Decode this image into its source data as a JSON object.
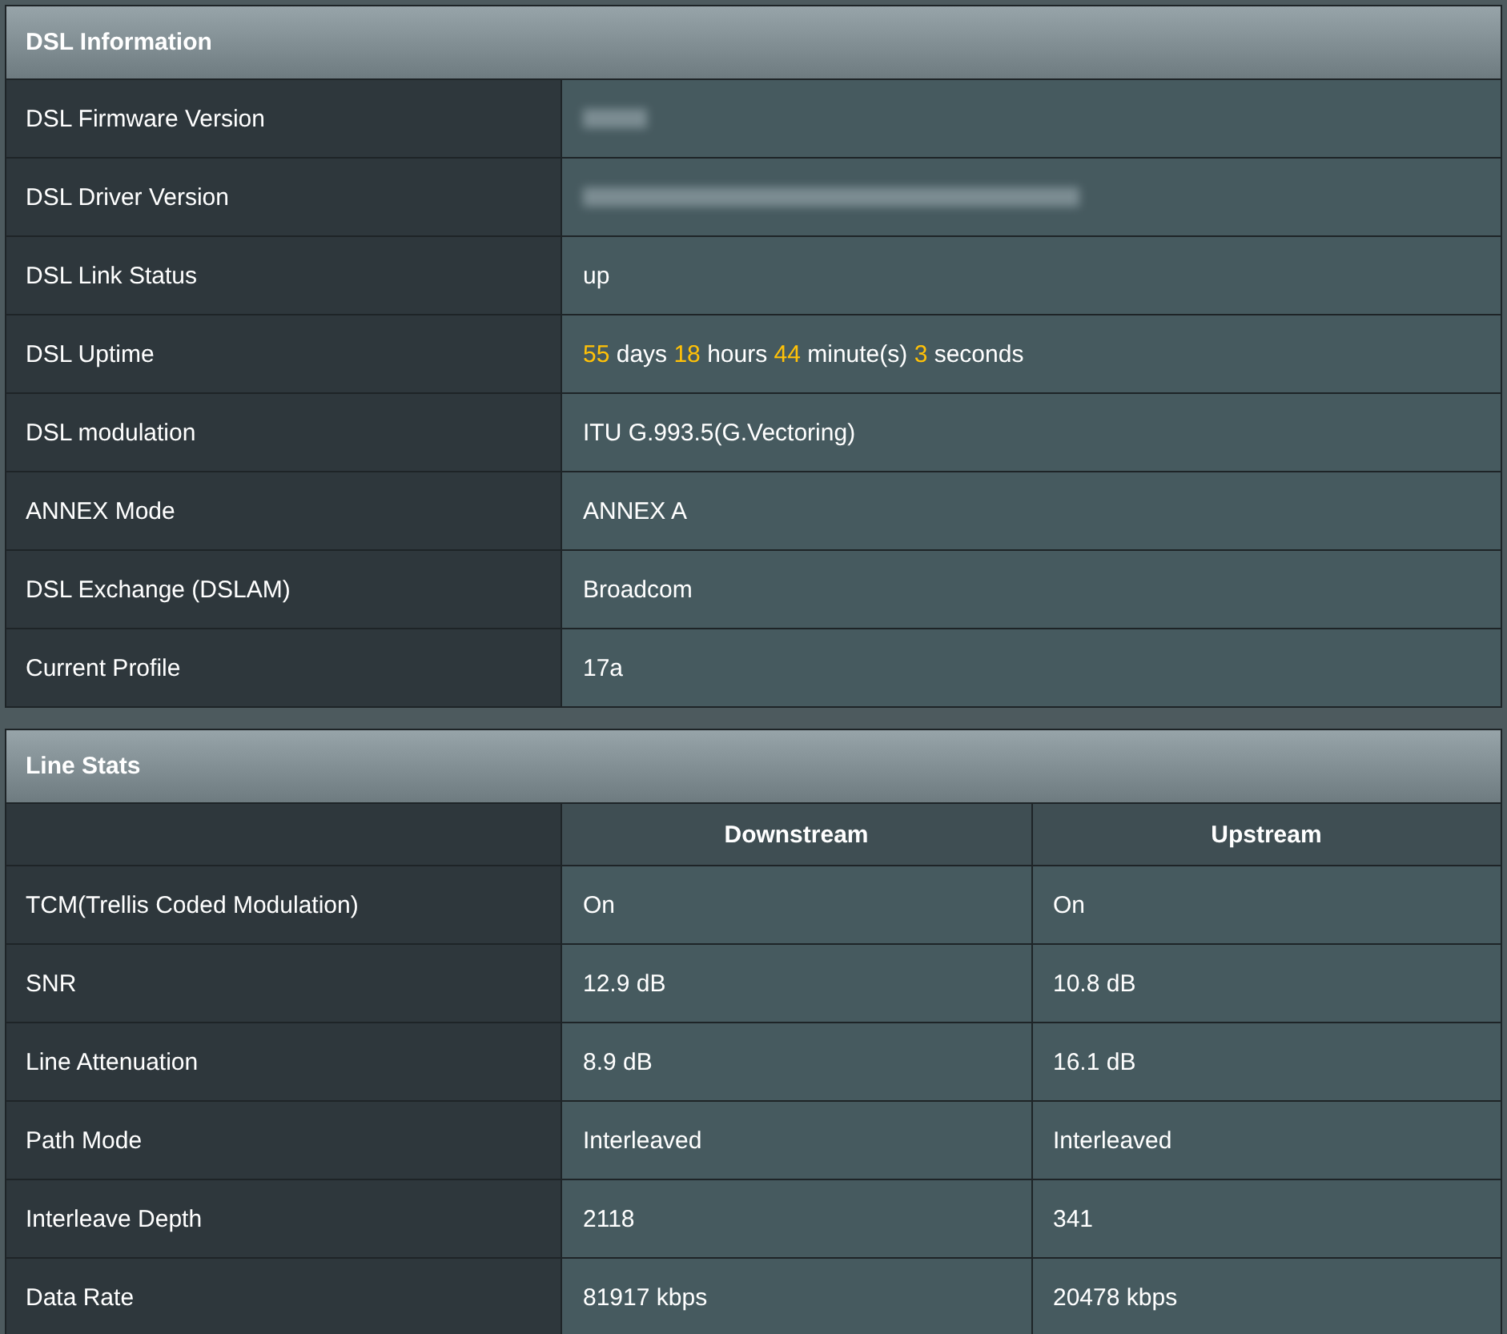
{
  "dsl_information": {
    "title": "DSL Information",
    "rows": [
      {
        "kind": "redacted",
        "label": "DSL Firmware Version"
      },
      {
        "kind": "redacted",
        "label": "DSL Driver Version"
      },
      {
        "kind": "text",
        "label": "DSL Link Status",
        "value": "up"
      },
      {
        "kind": "uptime",
        "label": "DSL Uptime",
        "segments": [
          {
            "kind": "number",
            "text": "55"
          },
          {
            "kind": "unit",
            "text": " days "
          },
          {
            "kind": "number",
            "text": "18"
          },
          {
            "kind": "unit",
            "text": " hours "
          },
          {
            "kind": "number",
            "text": "44"
          },
          {
            "kind": "unit",
            "text": " minute(s) "
          },
          {
            "kind": "number",
            "text": "3"
          },
          {
            "kind": "unit",
            "text": " seconds"
          }
        ]
      },
      {
        "kind": "text",
        "label": "DSL modulation",
        "value": "ITU G.993.5(G.Vectoring)"
      },
      {
        "kind": "text",
        "label": "ANNEX Mode",
        "value": "ANNEX A"
      },
      {
        "kind": "text",
        "label": "DSL Exchange (DSLAM)",
        "value": "Broadcom"
      },
      {
        "kind": "text",
        "label": "Current Profile",
        "value": "17a"
      }
    ]
  },
  "line_stats": {
    "title": "Line Stats",
    "columns": [
      "Downstream",
      "Upstream"
    ],
    "rows": [
      {
        "label": "TCM(Trellis Coded Modulation)",
        "downstream": "On",
        "upstream": "On"
      },
      {
        "label": "SNR",
        "downstream": "12.9 dB",
        "upstream": "10.8 dB"
      },
      {
        "label": "Line Attenuation",
        "downstream": "8.9 dB",
        "upstream": "16.1 dB"
      },
      {
        "label": "Path Mode",
        "downstream": "Interleaved",
        "upstream": "Interleaved"
      },
      {
        "label": "Interleave Depth",
        "downstream": "2118",
        "upstream": "341"
      },
      {
        "label": "Data Rate",
        "downstream": "81917 kbps",
        "upstream": "20478 kbps"
      }
    ]
  }
}
